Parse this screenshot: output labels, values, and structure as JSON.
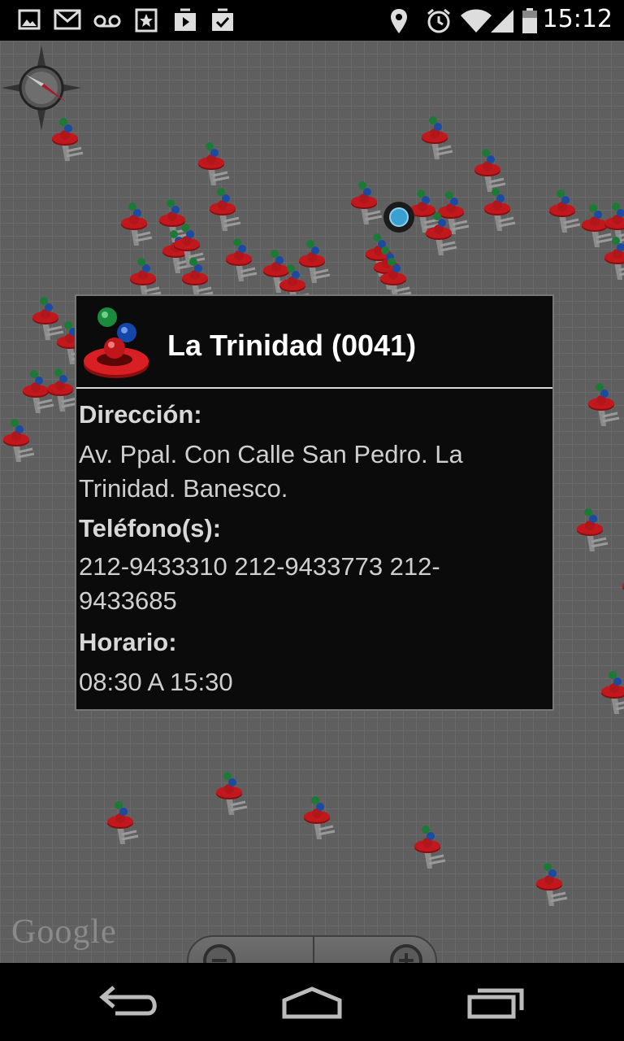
{
  "status_bar": {
    "time": "15:12",
    "left_icons": [
      "gallery-icon",
      "gmail-icon",
      "voicemail-icon",
      "star-app-icon",
      "play-store-icon",
      "task-check-icon"
    ],
    "right_icons": [
      "location-icon",
      "alarm-icon",
      "wifi-icon",
      "signal-icon",
      "battery-icon"
    ]
  },
  "map": {
    "attribution": "Google",
    "zoom_out_icon": "zoom-out-icon",
    "zoom_in_icon": "zoom-in-icon",
    "compass_icon": "compass-icon"
  },
  "info_window": {
    "title": "La Trinidad (0041)",
    "address_label": "Dirección:",
    "address_value": "Av. Ppal. Con Calle San Pedro. La Trinidad. Banesco.",
    "phone_label": "Teléfono(s):",
    "phone_value": "212-9433310 212-9433773 212-9433685",
    "hours_label": "Horario:",
    "hours_value": "08:30 A 15:30"
  },
  "nav_bar": {
    "icons": [
      "back-icon",
      "home-icon",
      "recent-apps-icon"
    ]
  },
  "colors": {
    "map_background": "#5f5f5f",
    "info_background": "#0b0b0b",
    "marker_red": "#c0181c",
    "location_blue": "#3aa0d0"
  }
}
